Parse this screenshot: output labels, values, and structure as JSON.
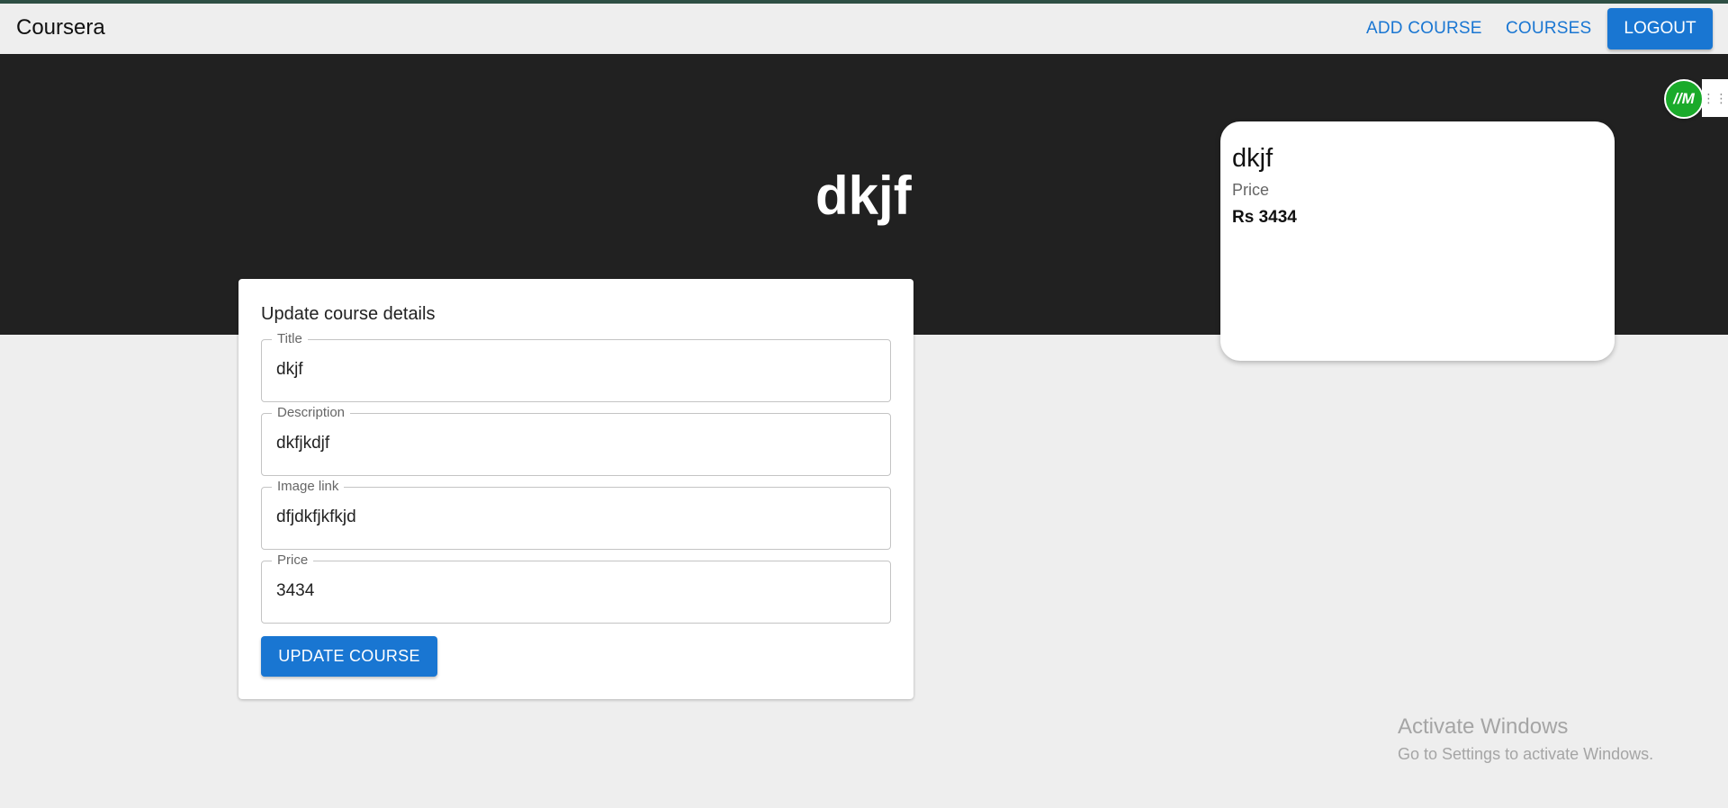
{
  "appbar": {
    "brand": "Coursera",
    "links": [
      "ADD COURSE",
      "COURSES"
    ],
    "logout_label": "LOGOUT"
  },
  "hero": {
    "title": "dkjf"
  },
  "extension": {
    "badge": "//M",
    "handle_icon": "drag-handle-icon"
  },
  "preview_card": {
    "title": "dkjf",
    "price_label": "Price",
    "price": "Rs 3434"
  },
  "form": {
    "heading": "Update course details",
    "fields": [
      {
        "label": "Title",
        "value": "dkjf"
      },
      {
        "label": "Description",
        "value": "dkfjkdjf"
      },
      {
        "label": "Image link",
        "value": "dfjdkfjkfkjd"
      },
      {
        "label": "Price",
        "value": "3434"
      }
    ],
    "submit_label": "UPDATE COURSE"
  },
  "watermark": {
    "title": "Activate Windows",
    "subtitle": "Go to Settings to activate Windows."
  },
  "colors": {
    "primary": "#1976d2",
    "hero_bg": "#212121",
    "page_bg": "#eeeeee"
  }
}
